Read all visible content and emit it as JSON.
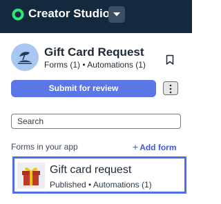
{
  "header": {
    "brand": "Creator Studio",
    "logo_icon": "ring-logo-icon",
    "switcher_icon": "caret-down-icon"
  },
  "app": {
    "icon": "beach-umbrella-icon",
    "title": "Gift Card Request",
    "subtitle": "Forms (1) • Automations (1)",
    "bookmark_icon": "bookmark-icon",
    "submit_label": "Submit for review",
    "more_icon": "vertical-ellipsis-icon"
  },
  "search": {
    "placeholder": "Search",
    "value": ""
  },
  "forms_section": {
    "label": "Forms in your app",
    "add_label": "Add form",
    "add_prefix": "+",
    "items": [
      {
        "title": "Gift card request",
        "subtitle": "Published • Automations (1)",
        "thumbnail": "gift-box-icon"
      }
    ]
  },
  "colors": {
    "topbar": "#13293d",
    "accent": "#5b77e6",
    "link": "#3b5bdb",
    "logo": "#2ee87a",
    "selection": "#4f6fe8"
  }
}
